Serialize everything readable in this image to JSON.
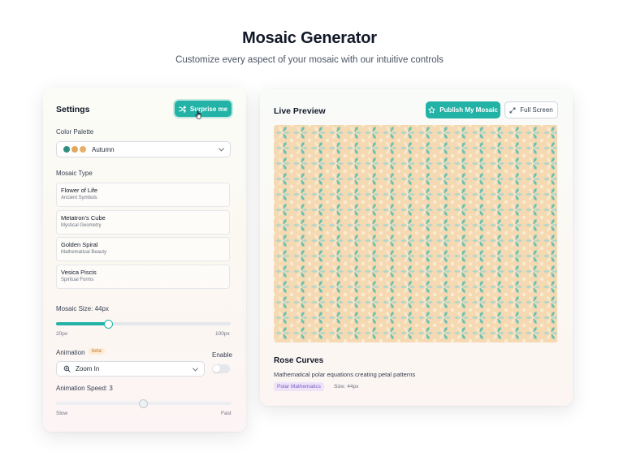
{
  "header": {
    "title": "Mosaic Generator",
    "subtitle": "Customize every aspect of your mosaic with our intuitive controls"
  },
  "settings": {
    "title": "Settings",
    "surprise_label": "Surprise me",
    "palette": {
      "label": "Color Palette",
      "selected": "Autumn",
      "swatches": [
        "#2f8f7c",
        "#e0a85a",
        "#e6b06a"
      ]
    },
    "mosaic_type": {
      "label": "Mosaic Type",
      "items": [
        {
          "name": "Flower of Life",
          "sub": "Ancient Symbols"
        },
        {
          "name": "Metatron's Cube",
          "sub": "Mystical Geometry"
        },
        {
          "name": "Golden Spiral",
          "sub": "Mathematical Beauty"
        },
        {
          "name": "Vesica Piscis",
          "sub": "Spiritual Forms"
        }
      ]
    },
    "size": {
      "label": "Mosaic Size: 44px",
      "value": 44,
      "min": 20,
      "max": 100,
      "min_label": "20px",
      "max_label": "100px"
    },
    "animation": {
      "label": "Animation",
      "badge": "beta",
      "enable_label": "Enable",
      "enabled": false,
      "selected": "Zoom In"
    },
    "speed": {
      "label": "Animation Speed: 3",
      "value": 3,
      "min": 1,
      "max": 5,
      "min_label": "Slow",
      "max_label": "Fast"
    }
  },
  "preview": {
    "title": "Live Preview",
    "publish_label": "Publish My Mosaic",
    "fullscreen_label": "Full Screen",
    "pattern_name": "Rose Curves",
    "pattern_desc": "Mathematical polar equations creating petal patterns",
    "tag_category": "Polar Mathematics",
    "tag_size": "Size: 44px",
    "colors": {
      "background": "#f5d9b2",
      "teal": "#5bbfb3",
      "pale": "#a9d8cf",
      "cream": "#faecd2"
    }
  },
  "colors": {
    "accent": "#22b3a6",
    "beta_bg": "#fdebd3",
    "beta_fg": "#c27a2c",
    "tag_bg": "#ede4fa",
    "tag_fg": "#7c5cc4"
  }
}
